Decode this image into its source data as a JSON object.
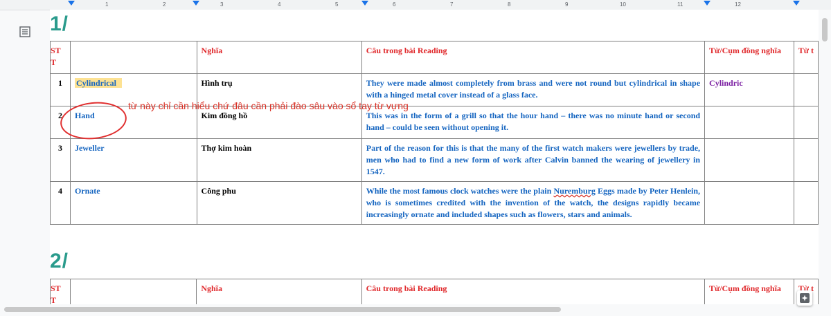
{
  "ruler": {
    "numbers": [
      "1",
      "2",
      "3",
      "4",
      "5",
      "6",
      "7",
      "8",
      "9",
      "10",
      "11",
      "12"
    ]
  },
  "sections": [
    {
      "heading": "1/",
      "headers": [
        "ST\nT",
        "",
        "Nghĩa",
        "Câu trong bài Reading",
        "Từ/Cụm đồng nghĩa",
        "Từ t"
      ],
      "rows": [
        {
          "stt": "1",
          "word": "Cylindrical",
          "meaning": "Hình trụ",
          "sentence": "They were made almost completely from brass and were not round but cylindrical in shape with a hinged metal cover instead of a glass face.",
          "synonym": "Cylindric"
        },
        {
          "stt": "2",
          "word": "Hand",
          "meaning": "Kim đồng hồ",
          "sentence": "This was in the form of a grill so that the hour hand – there was no minute hand or second hand – could be seen without opening it.",
          "synonym": ""
        },
        {
          "stt": "3",
          "word": "Jeweller",
          "meaning": "Thợ kim hoàn",
          "sentence": "Part of the reason for this is that the many of the first watch makers were jewellers by trade, men who had to find a new form of work after Calvin banned the wearing of jewellery in 1547.",
          "synonym": ""
        },
        {
          "stt": "4",
          "word": "Ornate",
          "meaning": "Công phu",
          "sentence_before": "While the most famous clock watches were the plain ",
          "sentence_misspelled": "Nuremburg",
          "sentence_after": " Eggs made by Peter Henlein, who is sometimes credited with the invention of the watch, the designs rapidly became increasingly ornate and included shapes such as flowers, stars and animals.",
          "synonym": ""
        }
      ]
    },
    {
      "heading": "2/",
      "headers": [
        "ST\nT",
        "",
        "Nghĩa",
        "Câu trong bài Reading",
        "Từ/Cụm đồng nghĩa",
        "Từ t"
      ]
    }
  ],
  "annotation": "từ này chỉ cần hiểu chứ đâu cần phải đào sâu vào sổ tay từ vựng",
  "icons": {
    "outline": "document-outline-icon",
    "explore": "explore-icon"
  },
  "colors": {
    "heading": "#2a9b8c",
    "header_text": "#e0282b",
    "word": "#1565c0",
    "synonym": "#7b1fa2",
    "annotation": "#d93025",
    "highlight": "#fde293"
  }
}
